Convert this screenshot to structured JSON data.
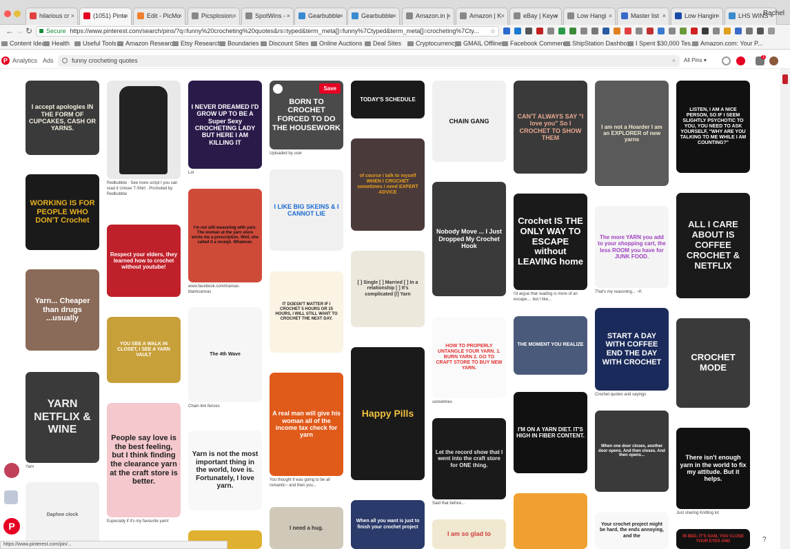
{
  "browser": {
    "tabs": [
      {
        "label": "hilarious cr",
        "fav": "#e04040"
      },
      {
        "label": "(1051) Pinte",
        "fav": "#e60023"
      },
      {
        "label": "Edit - PicMo",
        "fav": "#f08030"
      },
      {
        "label": "Picsplosion:",
        "fav": "#888888"
      },
      {
        "label": "SpotWins -",
        "fav": "#888888"
      },
      {
        "label": "Gearbubble",
        "fav": "#3a8ad0"
      },
      {
        "label": "Gearbubble",
        "fav": "#3a8ad0"
      },
      {
        "label": "Amazon.in |",
        "fav": "#888888"
      },
      {
        "label": "Amazon | K",
        "fav": "#888888"
      },
      {
        "label": "eBay | Keyw",
        "fav": "#888888"
      },
      {
        "label": "Low Hangi",
        "fav": "#888888"
      },
      {
        "label": "Master list",
        "fav": "#3a6ac8"
      },
      {
        "label": "Low Hangin",
        "fav": "#1a4aa8"
      },
      {
        "label": "LHS WINS",
        "fav": "#3a8ad0"
      }
    ],
    "profile": "Rachel",
    "url_secure_label": "Secure",
    "url": "https://www.pinterest.com/search/pins/?q=funny%20crocheting%20quotes&rs=typed&term_meta[]=funny%7Ctyped&term_meta[]=crocheting%7Cty...",
    "bookmarks": [
      "Content Ideas",
      "Health",
      "Useful Tools",
      "Amazon Research",
      "Etsy Research",
      "Boundaries",
      "Discount Sites",
      "Online Auctions",
      "Deal Sites",
      "Cryptocurrency",
      "GMAIL Offline",
      "Facebook Comment...",
      "ShipStation Dashbo...",
      "I Spent $30,000 Tes...",
      "Amazon.com: Your P..."
    ]
  },
  "pinterest": {
    "analytics_label": "Analytics",
    "ads_label": "Ads",
    "search_query": "funny crocheting quotes",
    "filter_label": "All Pins",
    "notification_count": "1"
  },
  "pins": {
    "c1": [
      {
        "text": "I accept apologies IN THE FORM OF CUPCAKES, CASH OR YARNS."
      },
      {
        "text": "WORKING IS FOR PEOPLE WHO DON'T Crochet"
      },
      {
        "text": "Yarn... Cheaper than drugs ...usually"
      },
      {
        "text": "YARN NETFLIX & WINE",
        "caption": "Yarn"
      },
      {
        "text": "Daphne clock"
      }
    ],
    "c2": [
      {
        "text": "",
        "caption": "Redbubble · See more script I you can read it Unisex T-Shirt · Promoted by Redbubble"
      },
      {
        "text": "Respect your elders, they learned how to crochet without youtube!"
      },
      {
        "text": "YOU SEE A WALK IN CLOSET, I SEE A YARN VAULT"
      },
      {
        "text": "People say love is the best feeling, but I think finding the clearance yarn at the craft store is better.",
        "caption": "Especially if it's my favourite yarn!"
      }
    ],
    "c3": [
      {
        "text": "I NEVER DREAMED I'D GROW UP TO BE A Super Sexy CROCHETING LADY BUT HERE I AM KILLING IT",
        "caption": "Lol"
      },
      {
        "text": "I'm not still weaseling with yarn. The woman at the yarn store wrote me a prescription. Well, she called it a receipt. Whatever.",
        "caption": "www.facebook.com/mamas-blankcanvas"
      },
      {
        "text": "The 4th Wave",
        "caption": "Chain link fences"
      },
      {
        "text": "Yarn is not the most important thing in the world, love is. Fortunately, I love yarn."
      }
    ],
    "c4": [
      {
        "text": "BORN TO CROCHET FORCED TO DO THE HOUSEWORK",
        "caption": "Uploaded by user",
        "save": "Save"
      },
      {
        "text": "I LIKE BIG SKEINS & I CANNOT LIE"
      },
      {
        "text": "IT DOESN'T MATTER IF I CROCHET 5 HOURS OR 15 HOURS, I WILL STILL WANT TO CROCHET THE NEXT DAY."
      },
      {
        "text": "A real man will give his woman all of the income tax check for yarn",
        "caption": "You thought it was going to be all romantic~ and then you..."
      },
      {
        "text": "I need a hug."
      }
    ],
    "c5": [
      {
        "text": "TODAY'S SCHEDULE"
      },
      {
        "text": "of course i talk to myself WHEN I CROCHET sometimes i need EXPERT ADVICE"
      },
      {
        "text": "[ ] Single [ ] Married [ ] In a relationship [ ] It's complicated [/] Yarn"
      },
      {
        "text": "Happy Pills"
      },
      {
        "text": "When all you want is just to finish your crochet project"
      }
    ],
    "c6": [
      {
        "text": "CHAIN GANG"
      },
      {
        "text": "Nobody Move ... I Just Dropped My Crochet Hook"
      },
      {
        "text": "HOW TO PROPERLY UNTANGLE YOUR YARN. 1. BURN YARN 2. GO TO CRAFT STORE TO BUY NEW YARN.",
        "caption": "sometimes"
      },
      {
        "text": "Let the record show that I went into the craft store for ONE thing.",
        "caption": "Said that before..."
      },
      {
        "text": "I am so glad to"
      }
    ],
    "c7": [
      {
        "text": "CAN'T ALWAYS SAY \"I love you\" So I CROCHET TO SHOW THEM"
      },
      {
        "text": "Crochet IS THE ONLY WAY TO ESCAPE without LEAVING home",
        "caption": "I'd argue that reading is more of an escape.... but I like..."
      },
      {
        "text": "THE MOMENT YOU REALIZE"
      },
      {
        "text": "I'M ON A YARN DIET. IT'S HIGH IN FIBER CONTENT."
      },
      {
        "text": ""
      }
    ],
    "c8": [
      {
        "text": "I am not a Hoarder I am an EXPLORER of new yarns"
      },
      {
        "text": "The more YARN you add to your shopping cart, the less ROOM you have for JUNK FOOD.",
        "caption": "That's my reasoning... ~K"
      },
      {
        "text": "START A DAY WITH COFFEE END THE DAY WITH CROCHET",
        "caption": "Crochet quotes and sayings"
      },
      {
        "text": "When one door closes, another door opens. And then closes. And then opens..."
      },
      {
        "text": "Your crochet project might be hard, the ends annoying, and the"
      }
    ],
    "c9": [
      {
        "text": "LISTEN, I AM A NICE PERSON, SO IF I SEEM SLIGHTLY PSYCHOTIC TO YOU, YOU NEED TO ASK YOURSELF, \"WHY ARE YOU TALKING TO ME WHILE I AM COUNTING?\""
      },
      {
        "text": "ALL I CARE ABOUT IS COFFEE CROCHET & NETFLIX"
      },
      {
        "text": "CROCHET MODE"
      },
      {
        "text": "There isn't enough yarn in the world to fix my attitude. But it helps.",
        "caption": "Just sharing Knitting lol"
      },
      {
        "text": "IN BED, IT'S GAM, YOU CLOSE YOUR EYES AND"
      }
    ]
  },
  "status_url": "https://www.pinterest.com/pin/...",
  "help_label": "?"
}
